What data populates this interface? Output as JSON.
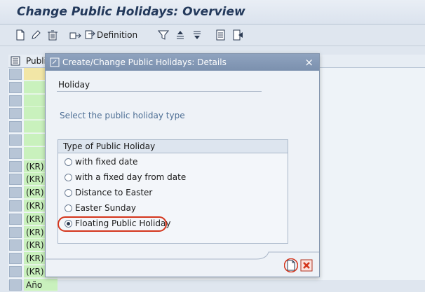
{
  "header": {
    "title": "Change Public Holidays: Overview"
  },
  "toolbar": {
    "definition_label": "Definition"
  },
  "grid": {
    "column_title": "Publi",
    "rows": [
      "",
      "",
      "",
      "",
      "",
      "",
      "",
      "(KR)",
      "(KR)",
      "(KR)",
      "(KR)",
      "(KR)",
      "(KR)",
      "(KR)",
      "(KR)",
      "(KR)",
      "Año"
    ]
  },
  "dialog": {
    "title": "Create/Change Public Holidays: Details",
    "section_title": "Holiday",
    "hint": "Select the public holiday type",
    "group_title": "Type of Public Holiday",
    "options": [
      "with fixed date",
      "with a fixed day from date",
      "Distance to Easter",
      "Easter Sunday",
      "Floating Public Holiday"
    ],
    "selected_option": "Floating Public Holiday",
    "close_symbol": "×"
  },
  "colors": {
    "highlight": "#d4351c",
    "cancel": "#d4351c",
    "accent": "#7b90ae"
  }
}
